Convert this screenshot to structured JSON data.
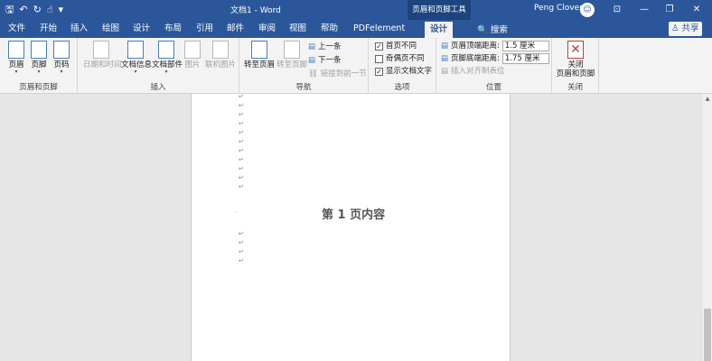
{
  "window": {
    "title": "文档1 - Word",
    "context_tab": "页眉和页脚工具",
    "user": "Peng Clover",
    "avatar_initial": "☺"
  },
  "qat": {
    "save": "🖫",
    "undo": "↶",
    "redo": "↻",
    "touch": "☝",
    "more": "▾"
  },
  "tabs": [
    "文件",
    "开始",
    "插入",
    "绘图",
    "设计",
    "布局",
    "引用",
    "邮件",
    "审阅",
    "视图",
    "帮助",
    "PDFelement",
    "设计"
  ],
  "search_label": "🔍 搜索",
  "share_label": "♙ 共享",
  "ribbon": {
    "header_footer_group": {
      "label": "页眉和页脚",
      "buttons": [
        "页眉",
        "页脚",
        "页码"
      ]
    },
    "insert_group": {
      "label": "插入",
      "buttons": [
        "日期和时间",
        "文档信息",
        "文档部件",
        "图片",
        "联机图片"
      ]
    },
    "nav_group": {
      "label": "导航",
      "goto_header": "转至页眉",
      "goto_footer": "转至页脚",
      "prev": "上一条",
      "next": "下一条",
      "link_prev": "链接到前一节"
    },
    "options_group": {
      "label": "选项",
      "first_page_different": "首页不同",
      "odd_even_different": "奇偶页不同",
      "show_doc_text": "显示文档文字",
      "first_page_checked": true,
      "odd_even_checked": false,
      "show_doc_text_checked": true
    },
    "position_group": {
      "label": "位置",
      "header_top": "页眉顶端距离:",
      "header_top_value": "1.5 厘米",
      "footer_bottom": "页脚底端距离:",
      "footer_bottom_value": "1.75 厘米",
      "insert_align_tab": "插入对齐制表位"
    },
    "close_group": {
      "label": "关闭",
      "close_line1": "关闭",
      "close_line2": "页眉和页脚"
    }
  },
  "document": {
    "heading": "第 1 页内容",
    "para_mark": "↵"
  }
}
